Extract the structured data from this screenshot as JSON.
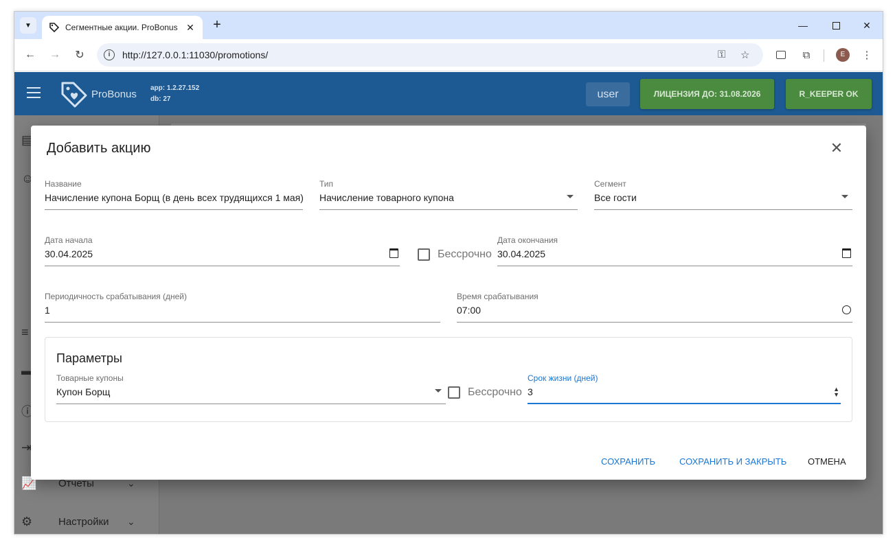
{
  "browser": {
    "tab_title": "Сегментные акции. ProBonus",
    "url": "http://127.0.0.1:11030/promotions/",
    "avatar_letter": "E"
  },
  "app": {
    "logo_text": "ProBonus",
    "version_app": "app: 1.2.27.152",
    "version_db": "db: 27",
    "user_button": "user",
    "license_button": "ЛИЦЕНЗИЯ ДО: 31.08.2026",
    "rkeeper_button": "R_KEEPER OK",
    "appbar_color": "#1d5a93"
  },
  "drawer": {
    "items": [
      {
        "label": "Отчеты",
        "icon": "chart-icon"
      },
      {
        "label": "Настройки",
        "icon": "gear-icon"
      }
    ]
  },
  "dialog": {
    "title": "Добавить акцию",
    "name_label": "Название",
    "name_value": "Начисление купона Борщ (в день всех трудящихся 1 мая)",
    "type_label": "Тип",
    "type_value": "Начисление товарного купона",
    "segment_label": "Сегмент",
    "segment_value": "Все гости",
    "start_label": "Дата начала",
    "start_value": "30.04.2025",
    "unlimited_label": "Бессрочно",
    "end_label": "Дата окончания",
    "end_value": "30.04.2025",
    "period_label": "Периодичность срабатывания (дней)",
    "period_value": "1",
    "time_label": "Время срабатывания",
    "time_value": "07:00",
    "params_title": "Параметры",
    "coupons_label": "Товарные купоны",
    "coupons_value": "Купон Борщ",
    "coupon_unlimited_label": "Бессрочно",
    "lifetime_label": "Срок жизни (дней)",
    "lifetime_value": "3",
    "save_label": "СОХРАНИТЬ",
    "save_close_label": "СОХРАНИТЬ И ЗАКРЫТЬ",
    "cancel_label": "ОТМЕНА",
    "accent_color": "#1976d2"
  }
}
